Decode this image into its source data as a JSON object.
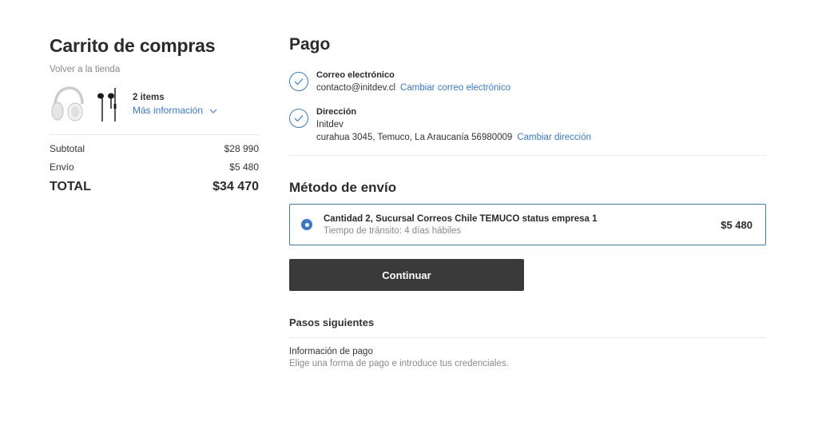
{
  "cart": {
    "title": "Carrito de compras",
    "back_link": "Volver a la tienda",
    "items_count": "2 items",
    "more_info": "Más información",
    "products": [
      {
        "icon": "headphones-icon"
      },
      {
        "icon": "earphones-icon"
      }
    ],
    "subtotal_label": "Subtotal",
    "subtotal_value": "$28 990",
    "shipping_label": "Envío",
    "shipping_value": "$5 480",
    "total_label": "TOTAL",
    "total_value": "$34 470"
  },
  "payment": {
    "title": "Pago",
    "email": {
      "label": "Correo electrónico",
      "value": "contacto@initdev.cl",
      "change": "Cambiar correo electrónico"
    },
    "address": {
      "label": "Dirección",
      "name": "Initdev",
      "value": "curahua 3045, Temuco, La Araucanía 56980009",
      "change": "Cambiar dirección"
    }
  },
  "shipping_method": {
    "title": "Método de envío",
    "option": {
      "name": "Cantidad 2, Sucursal Correos Chile TEMUCO status empresa 1",
      "time": "Tiempo de tránsito: 4 días hábiles",
      "price": "$5 480",
      "selected": true
    },
    "continue": "Continuar"
  },
  "next_steps": {
    "title": "Pasos siguientes",
    "steps": [
      {
        "title": "Información de pago",
        "desc": "Elige una forma de pago e introduce tus credenciales."
      }
    ]
  },
  "colors": {
    "accent": "#3b79c6",
    "button": "#3a3a3a",
    "muted": "#8a8a8a"
  }
}
